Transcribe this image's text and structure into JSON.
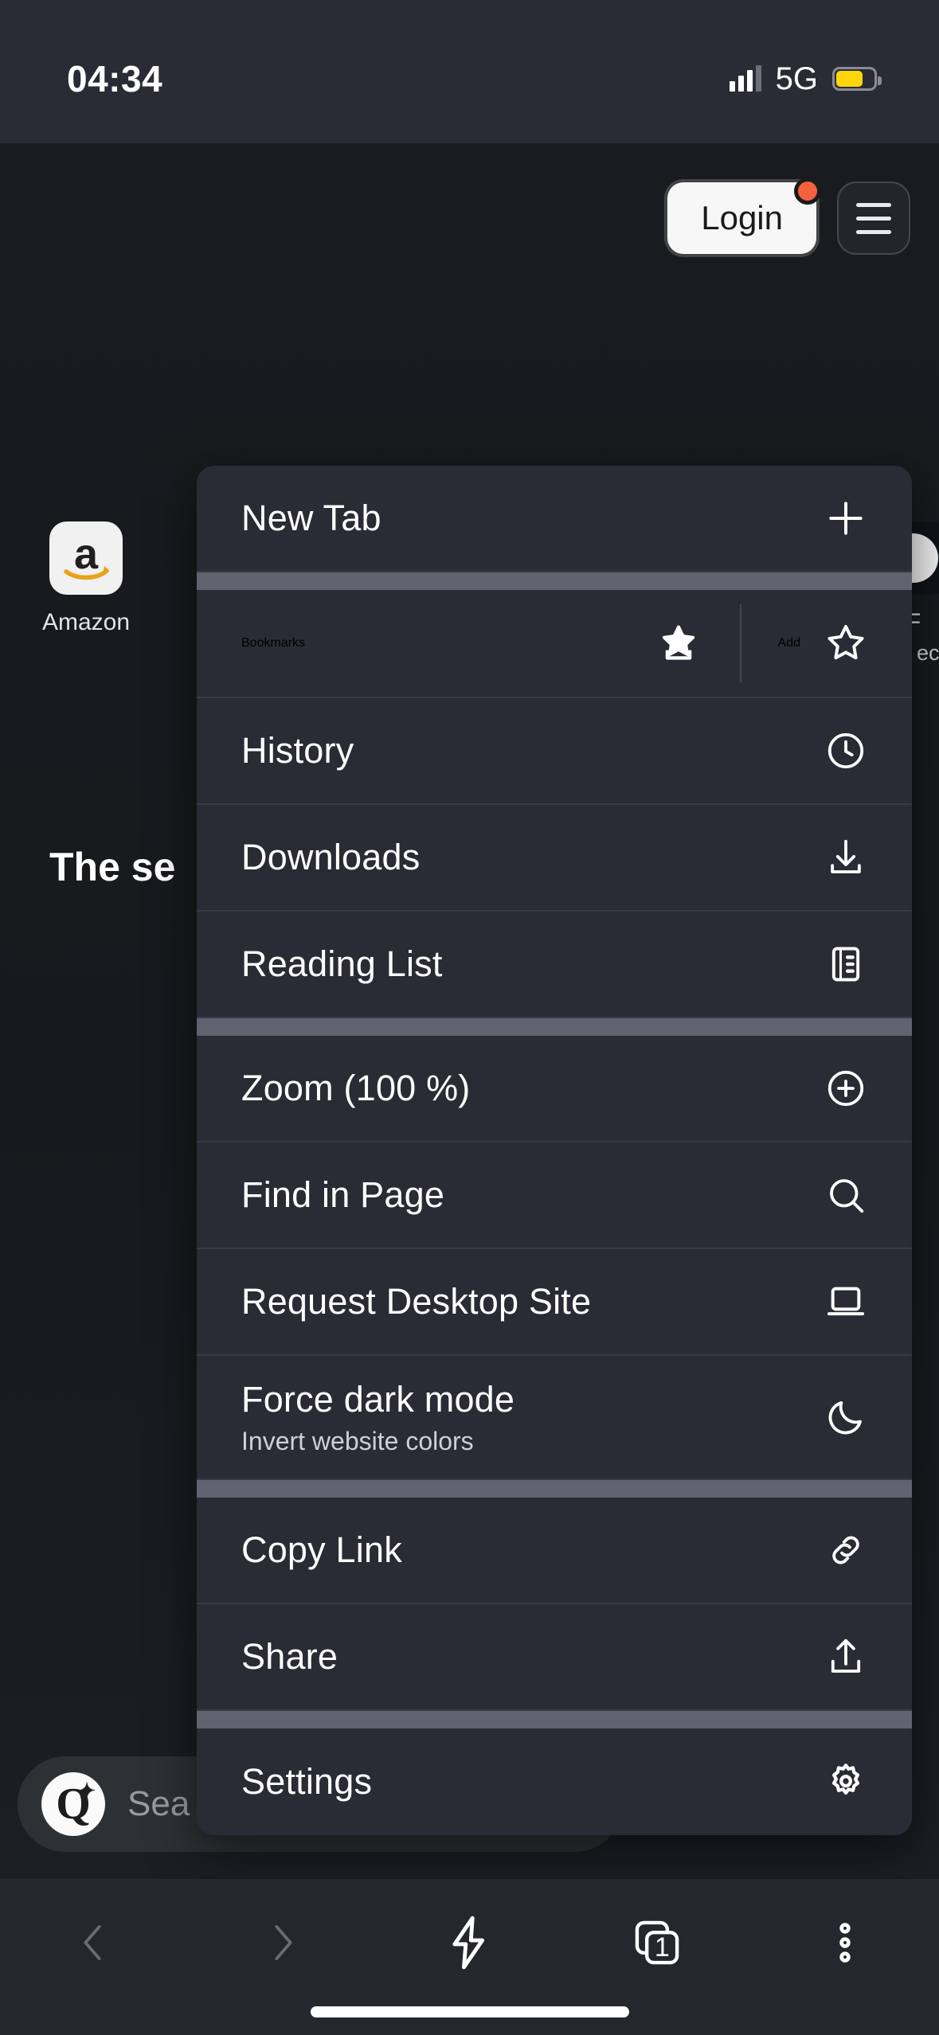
{
  "status_bar": {
    "time": "04:34",
    "network": "5G",
    "signal_icon": "signal-bars-icon",
    "battery_icon": "battery-icon",
    "battery_color": "#ffd60a"
  },
  "page": {
    "login_label": "Login",
    "login_badge_color": "#f4613c",
    "menu_icon": "hamburger-icon",
    "hero_text": "The se",
    "shortcuts": [
      {
        "label": "Amazon",
        "icon": "amazon-logo-icon"
      },
      {
        "label": "F",
        "sub": "ect",
        "icon": "shortcut-tile-icon"
      }
    ],
    "search": {
      "logo": "qwant-q-icon",
      "logo_letter": "Q",
      "placeholder": "Sea"
    }
  },
  "menu": {
    "items": [
      {
        "label": "New Tab",
        "icon": "plus-icon"
      },
      {
        "label": "Bookmarks",
        "icon": "bookmark-star-icon",
        "action_label": "Add",
        "action_icon": "star-outline-icon"
      },
      {
        "label": "History",
        "icon": "clock-icon"
      },
      {
        "label": "Downloads",
        "icon": "download-icon"
      },
      {
        "label": "Reading List",
        "icon": "reading-list-icon"
      },
      {
        "label": "Zoom (100 %)",
        "icon": "zoom-in-icon"
      },
      {
        "label": "Find in Page",
        "icon": "search-icon"
      },
      {
        "label": "Request Desktop Site",
        "icon": "laptop-icon"
      },
      {
        "label": "Force dark mode",
        "sublabel": "Invert website colors",
        "icon": "moon-icon"
      },
      {
        "label": "Copy Link",
        "icon": "link-icon"
      },
      {
        "label": "Share",
        "icon": "share-icon"
      },
      {
        "label": "Settings",
        "icon": "gear-icon"
      }
    ]
  },
  "toolbar": {
    "back_icon": "chevron-left-icon",
    "forward_icon": "chevron-right-icon",
    "turbo_icon": "lightning-bolt-icon",
    "tabs_icon": "tab-stack-icon",
    "tab_count": "1",
    "more_icon": "three-dots-icon"
  }
}
